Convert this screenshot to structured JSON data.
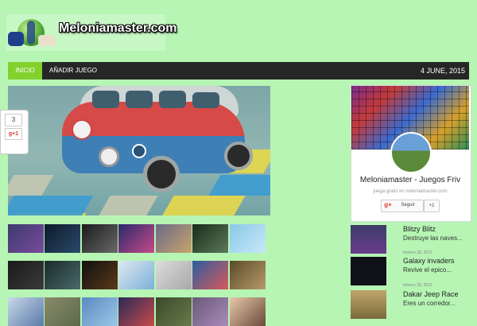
{
  "header": {
    "logo_text": "Meloniamaster.com",
    "logo_icon": "globe-mascot-icon"
  },
  "nav": {
    "items": [
      {
        "label": "INICIO",
        "active": true
      },
      {
        "label": "AÑADIR JUEGO",
        "active": false
      }
    ],
    "date": "4 JUNE, 2015",
    "accent_color": "#82d12d",
    "bar_color": "#262626"
  },
  "share": {
    "count": "3",
    "gplus_label": "g+1"
  },
  "widget": {
    "title": "Meloniamaster - Juegos Friv",
    "subtitle": "juega gratis en meloniamaster.com",
    "follow_label": "Seguir",
    "plus_one_label": "+1"
  },
  "recent_games": [
    {
      "title": "Blitzy Blitz",
      "desc": "Destruye las naves...",
      "date": ""
    },
    {
      "title": "Galaxy invaders",
      "desc": "Revive el epico...",
      "date": "febrero 28, 2015"
    },
    {
      "title": "Dakar Jeep Race",
      "desc": "Eres un corredor...",
      "date": "febrero 28, 2015"
    }
  ],
  "colors": {
    "page_bg": "#b6f5b4",
    "gplus_red": "#d73d32"
  }
}
